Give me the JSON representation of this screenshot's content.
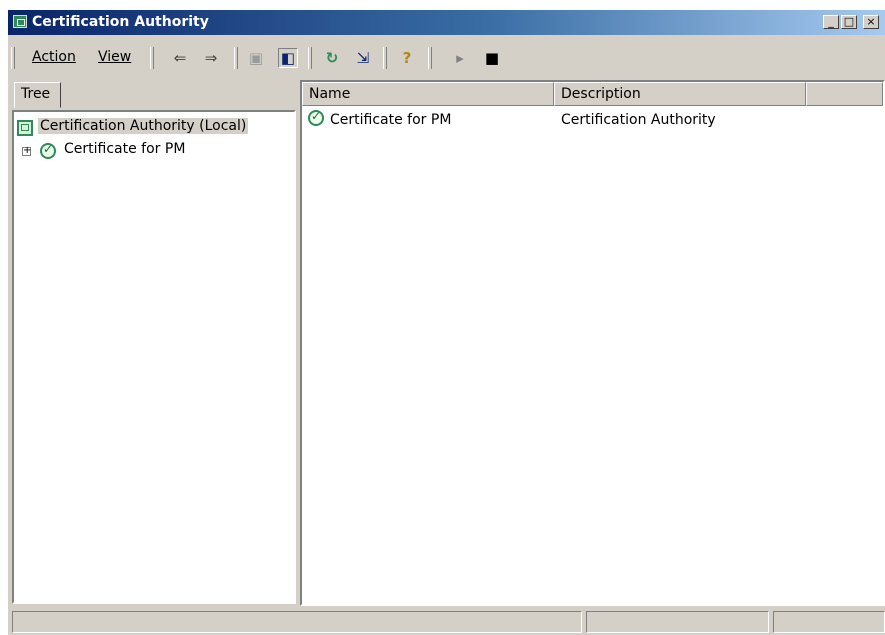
{
  "window": {
    "title": "Certification Authority",
    "buttons": {
      "minimize": "_",
      "maximize": "□",
      "close": "×"
    }
  },
  "menu": {
    "action": "Action",
    "view": "View"
  },
  "toolbar": {
    "icons": [
      "back-arrow-icon",
      "forward-arrow-icon",
      "up-folder-icon",
      "show-hide-tree-icon",
      "refresh-icon",
      "export-list-icon",
      "help-icon",
      "start-service-icon",
      "stop-service-icon"
    ],
    "glyphs": {
      "back": "⇐",
      "forward": "⇒",
      "up": "▣",
      "tree": "◧",
      "refresh": "↻",
      "export": "⇲",
      "help": "?",
      "start": "▸",
      "stop": "■"
    }
  },
  "tree": {
    "tab_label": "Tree",
    "root": {
      "label": "Certification Authority (Local)"
    },
    "children": [
      {
        "label": "Certificate for PM",
        "expander": "+"
      }
    ]
  },
  "list": {
    "columns": [
      "Name",
      "Description",
      ""
    ],
    "rows": [
      {
        "name": "Certificate for PM",
        "description": "Certification Authority"
      }
    ]
  },
  "statusbar": {
    "panes": [
      "",
      "",
      ""
    ]
  },
  "colors": {
    "titlebar_start": "#0a246a",
    "titlebar_end": "#a6caf0",
    "face": "#d4d0c8",
    "ca_icon": "#2e8b57"
  }
}
